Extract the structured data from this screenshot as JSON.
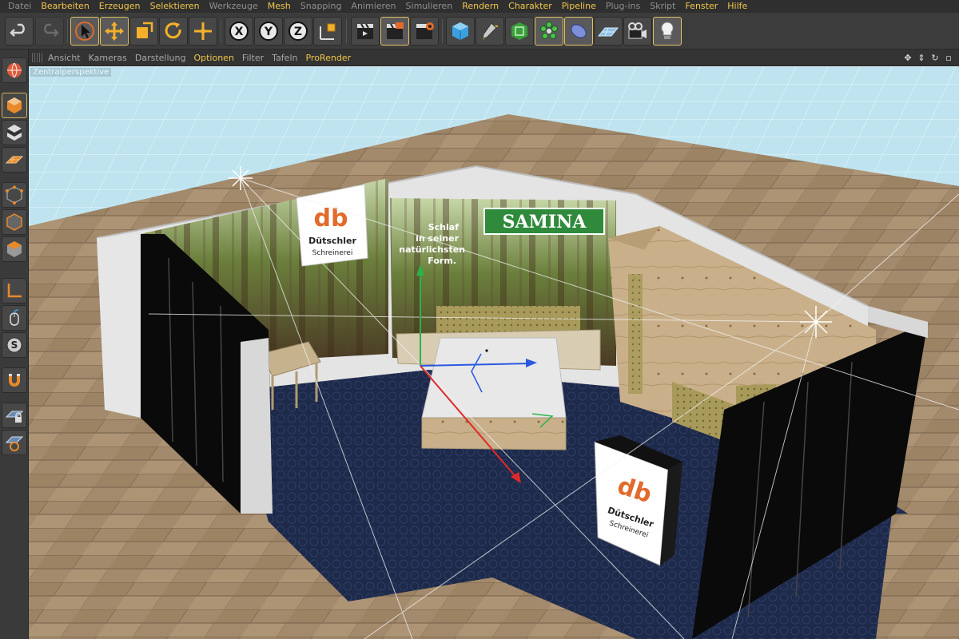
{
  "menubar": {
    "items": [
      {
        "label": "Datei",
        "style": "dim"
      },
      {
        "label": "Bearbeiten",
        "style": "hl"
      },
      {
        "label": "Erzeugen",
        "style": "hl"
      },
      {
        "label": "Selektieren",
        "style": "hl"
      },
      {
        "label": "Werkzeuge",
        "style": "dim"
      },
      {
        "label": "Mesh",
        "style": "hl"
      },
      {
        "label": "Snapping",
        "style": "dim"
      },
      {
        "label": "Animieren",
        "style": "dim"
      },
      {
        "label": "Simulieren",
        "style": "dim"
      },
      {
        "label": "Rendern",
        "style": "hl"
      },
      {
        "label": "Charakter",
        "style": "hl"
      },
      {
        "label": "Pipeline",
        "style": "hl"
      },
      {
        "label": "Plug-ins",
        "style": "dim"
      },
      {
        "label": "Skript",
        "style": "dim"
      },
      {
        "label": "Fenster",
        "style": "hl"
      },
      {
        "label": "Hilfe",
        "style": "hl"
      }
    ]
  },
  "toolbar": {
    "axis_x": "X",
    "axis_y": "Y",
    "axis_z": "Z"
  },
  "viewport_menu": {
    "items": [
      {
        "label": "Ansicht",
        "style": "dim"
      },
      {
        "label": "Kameras",
        "style": "dim"
      },
      {
        "label": "Darstellung",
        "style": "dim"
      },
      {
        "label": "Optionen",
        "style": "hl"
      },
      {
        "label": "Filter",
        "style": "dim"
      },
      {
        "label": "Tafeln",
        "style": "dim"
      },
      {
        "label": "ProRender",
        "style": "hl"
      }
    ]
  },
  "viewport": {
    "camera_label": "Zentralperspektive"
  },
  "scene": {
    "logo_letters": "db",
    "brand_name": "Dütschler",
    "brand_sub": "Schreinerei",
    "samina_logo": "SAMINA",
    "slogan_lines": [
      "Schlaf",
      "in seiner",
      "natürlichsten",
      "Form."
    ],
    "colors": {
      "sky": "#bfe4f0",
      "floor": "#a48a6c",
      "carpet": "#1e2a4a",
      "logo_orange": "#e26a2c",
      "samina_green": "#2f8a3c",
      "wood": "#c9b08a",
      "panel_black": "#0a0a0a"
    }
  }
}
